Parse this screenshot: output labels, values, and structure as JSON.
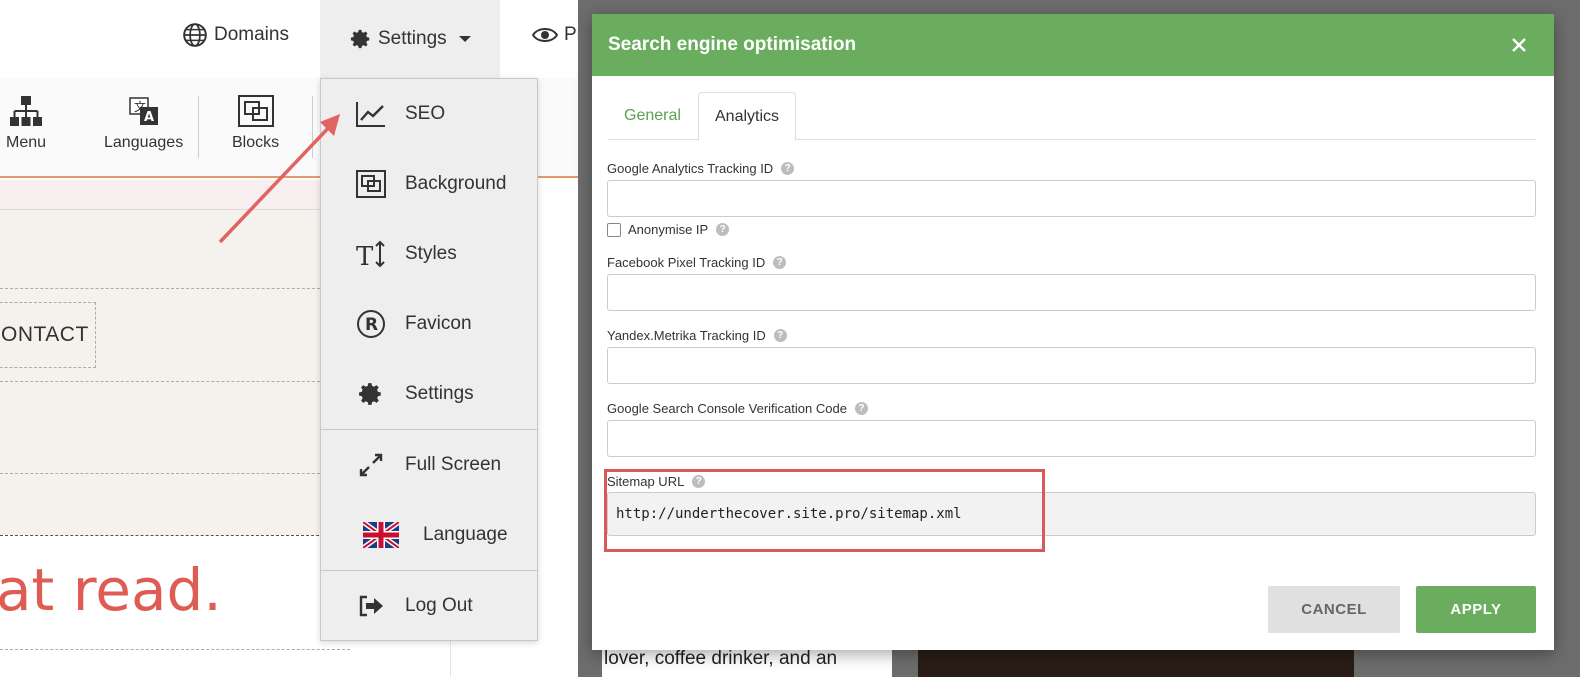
{
  "topnav": {
    "domains_label": "Domains",
    "settings_label": "Settings",
    "preview_label_partial": "Pr"
  },
  "toolbar": {
    "items": [
      {
        "label": "Menu",
        "icon": "sitemap-icon"
      },
      {
        "label": "Languages",
        "icon": "translate-icon"
      },
      {
        "label": "Blocks",
        "icon": "blocks-icon"
      }
    ]
  },
  "canvas": {
    "contact_partial": "ONTACT",
    "hero_partial": "at read."
  },
  "settings_menu": {
    "items": [
      {
        "label": "SEO",
        "icon": "trending-chart-icon"
      },
      {
        "label": "Background",
        "icon": "background-icon"
      },
      {
        "label": "Styles",
        "icon": "text-size-icon"
      },
      {
        "label": "Favicon",
        "icon": "registered-icon"
      },
      {
        "label": "Settings",
        "icon": "gear-icon"
      },
      {
        "label": "Full Screen",
        "icon": "expand-icon"
      },
      {
        "label": "Language",
        "icon": "uk-flag-icon"
      },
      {
        "label": "Log Out",
        "icon": "logout-icon"
      }
    ]
  },
  "background_fragments": {
    "bottom_text": "lover, coffee drinker, and an"
  },
  "modal": {
    "title": "Search engine optimisation",
    "tabs": [
      "General",
      "Analytics"
    ],
    "active_tab": "Analytics",
    "fields": {
      "ga_label": "Google Analytics Tracking ID",
      "ga_value": "",
      "anonymise_label": "Anonymise IP",
      "anonymise_checked": false,
      "fb_label": "Facebook Pixel Tracking ID",
      "fb_value": "",
      "yandex_label": "Yandex.Metrika Tracking ID",
      "yandex_value": "",
      "gsc_label": "Google Search Console Verification Code",
      "gsc_value": "",
      "sitemap_label": "Sitemap URL",
      "sitemap_value": "http://underthecover.site.pro/sitemap.xml"
    },
    "cancel_label": "CANCEL",
    "apply_label": "APPLY"
  },
  "colors": {
    "accent_green": "#6aad5f",
    "highlight_red": "#d9585a",
    "hero_red": "#df5c55"
  }
}
